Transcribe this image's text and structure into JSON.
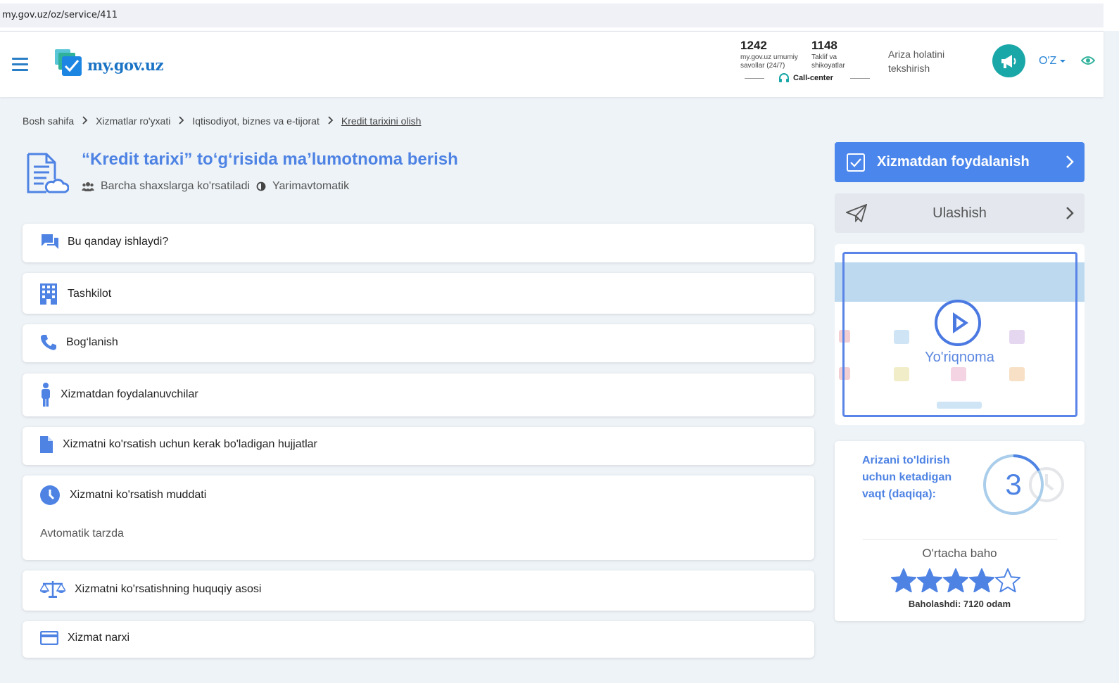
{
  "browser": {
    "url": "my.gov.uz/oz/service/411"
  },
  "header": {
    "logo_text": "my.gov.uz",
    "stats": [
      {
        "num": "1242",
        "label1": "my.gov.uz umumiy",
        "label2": "savollar (24/7)"
      },
      {
        "num": "1148",
        "label1": "Taklif va",
        "label2": "shikoyatlar"
      }
    ],
    "callcenter": "Call-center",
    "ariza_line1": "Ariza holatini",
    "ariza_line2": "tekshirish",
    "lang": "O'Z"
  },
  "breadcrumb": [
    "Bosh sahifa",
    "Xizmatlar ro'yxati",
    "Iqtisodiyot, biznes va e-tijorat",
    "Kredit tarixini olish"
  ],
  "service": {
    "title": "“Kredit tarixi” to‘g‘risida ma’lumotnoma berish",
    "audience": "Barcha shaxslarga ko'rsatiladi",
    "mode": "Yarimavtomatik"
  },
  "sections": [
    {
      "label": "Bu qanday ishlaydi?",
      "icon": "chat-icon"
    },
    {
      "label": "Tashkilot",
      "icon": "building-icon"
    },
    {
      "label": "Bog‘lanish",
      "icon": "phone-icon"
    },
    {
      "label": "Xizmatdan foydalanuvchilar",
      "icon": "person-icon"
    },
    {
      "label": "Xizmatni ko'rsatish uchun kerak bo'ladigan hujjatlar",
      "icon": "document-icon"
    },
    {
      "label": "Xizmatni ko'rsatish muddati",
      "icon": "clock-icon",
      "detail": "Avtomatik tarzda"
    },
    {
      "label": "Xizmatni ko'rsatishning huquqiy asosi",
      "icon": "scales-icon"
    },
    {
      "label": "Xizmat narxi",
      "icon": "credit-card-icon"
    }
  ],
  "sidebar": {
    "primary_button": "Xizmatdan foydalanish",
    "share_button": "Ulashish",
    "video_label": "Yo'riqnoma",
    "time_label": "Arizani to'ldirish uchun ketadigan vaqt (daqiqa):",
    "time_value": "3",
    "avg_label": "O'rtacha baho",
    "rating": 4,
    "rating_max": 5,
    "votes": "Baholashdi: 7120 odam"
  },
  "colors": {
    "accent": "#4e83e4",
    "primary_button": "#4b86ec",
    "teal": "#1aa7a8"
  }
}
